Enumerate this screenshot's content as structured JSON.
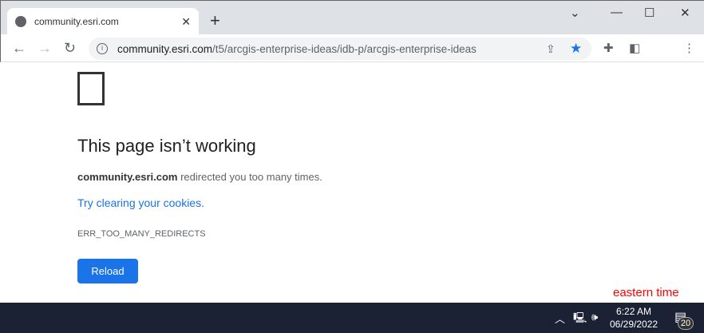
{
  "tab": {
    "title": "community.esri.com"
  },
  "omnibox": {
    "host": "community.esri.com",
    "path": "/t5/arcgis-enterprise-ideas/idb-p/arcgis-enterprise-ideas"
  },
  "error": {
    "title": "This page isn’t working",
    "host": "community.esri.com",
    "message": " redirected you too many times.",
    "link": "Try clearing your cookies.",
    "code": "ERR_TOO_MANY_REDIRECTS",
    "reload": "Reload"
  },
  "annotation": "eastern time",
  "taskbar": {
    "time": "6:22 AM",
    "date": "06/29/2022",
    "notifications": "20"
  }
}
